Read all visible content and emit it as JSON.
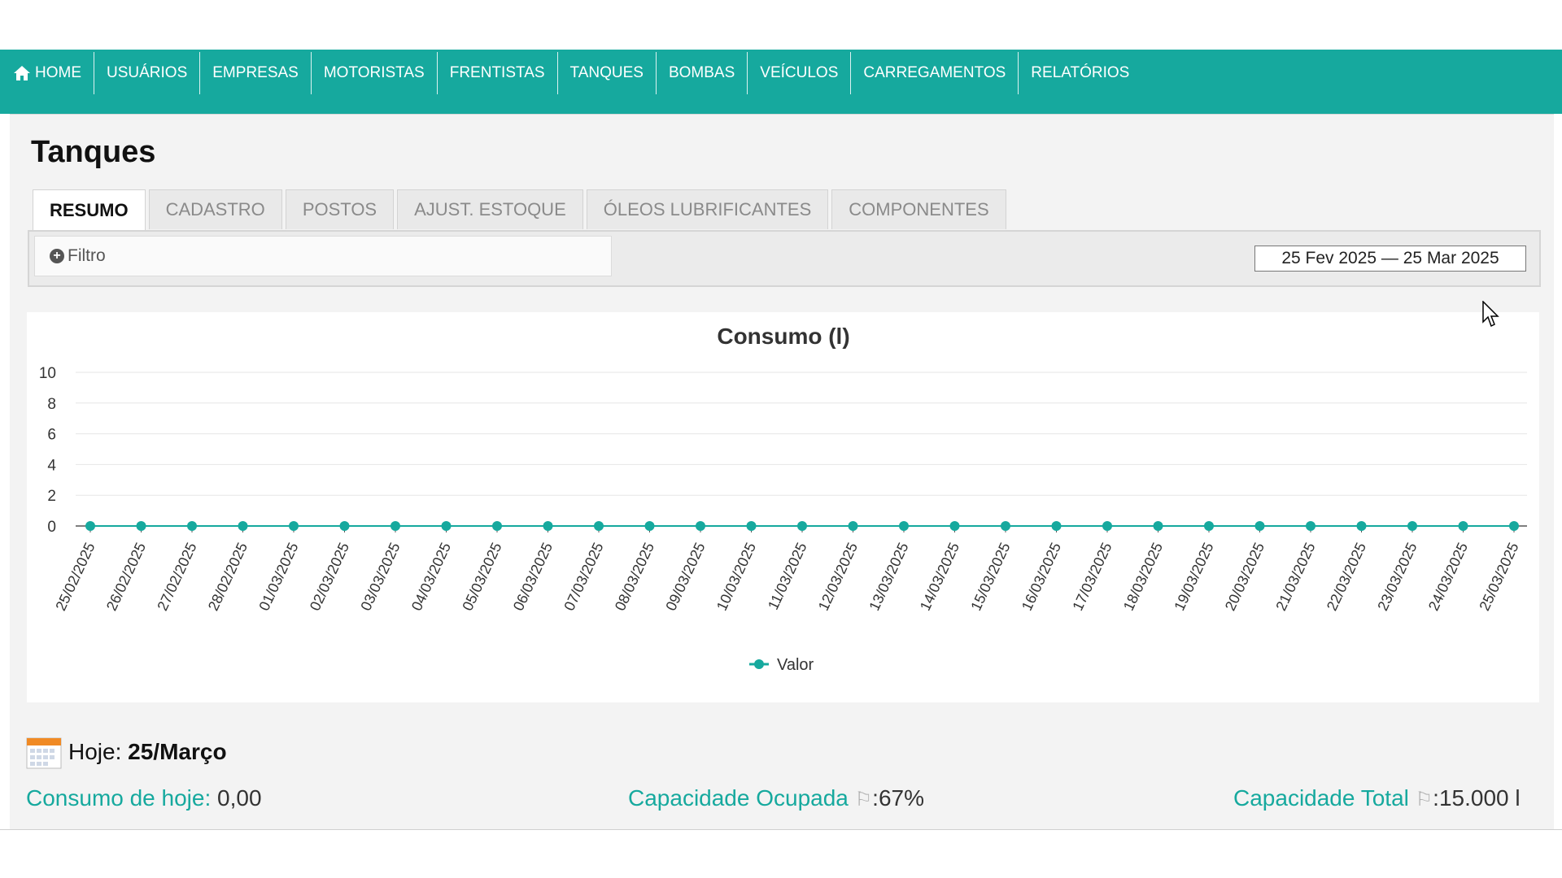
{
  "nav": {
    "items": [
      {
        "label": "HOME",
        "icon": "home-icon"
      },
      {
        "label": "USUÁRIOS"
      },
      {
        "label": "EMPRESAS"
      },
      {
        "label": "MOTORISTAS"
      },
      {
        "label": "FRENTISTAS"
      },
      {
        "label": "TANQUES"
      },
      {
        "label": "BOMBAS"
      },
      {
        "label": "VEÍCULOS"
      },
      {
        "label": "CARREGAMENTOS"
      },
      {
        "label": "RELATÓRIOS"
      }
    ]
  },
  "page": {
    "title": "Tanques"
  },
  "tabs": [
    {
      "label": "RESUMO",
      "active": true
    },
    {
      "label": "CADASTRO"
    },
    {
      "label": "POSTOS"
    },
    {
      "label": "AJUST. ESTOQUE"
    },
    {
      "label": "ÓLEOS LUBRIFICANTES"
    },
    {
      "label": "COMPONENTES"
    }
  ],
  "filter": {
    "label": "Filtro",
    "icon": "plus-circle-icon"
  },
  "date_range": {
    "label": "25 Fev 2025 — 25 Mar 2025"
  },
  "chart_data": {
    "type": "line",
    "title": "Consumo (l)",
    "xlabel": "",
    "ylabel": "",
    "ylim": [
      0,
      10
    ],
    "yticks": [
      0,
      2,
      4,
      6,
      8,
      10
    ],
    "grid": true,
    "legend_position": "bottom-center",
    "categories": [
      "25/02/2025",
      "26/02/2025",
      "27/02/2025",
      "28/02/2025",
      "01/03/2025",
      "02/03/2025",
      "03/03/2025",
      "04/03/2025",
      "05/03/2025",
      "06/03/2025",
      "07/03/2025",
      "08/03/2025",
      "09/03/2025",
      "10/03/2025",
      "11/03/2025",
      "12/03/2025",
      "13/03/2025",
      "14/03/2025",
      "15/03/2025",
      "16/03/2025",
      "17/03/2025",
      "18/03/2025",
      "19/03/2025",
      "20/03/2025",
      "21/03/2025",
      "22/03/2025",
      "23/03/2025",
      "24/03/2025",
      "25/03/2025"
    ],
    "series": [
      {
        "name": "Valor",
        "color": "#16a99e",
        "values": [
          0,
          0,
          0,
          0,
          0,
          0,
          0,
          0,
          0,
          0,
          0,
          0,
          0,
          0,
          0,
          0,
          0,
          0,
          0,
          0,
          0,
          0,
          0,
          0,
          0,
          0,
          0,
          0,
          0
        ]
      }
    ]
  },
  "today": {
    "label": "Hoje:",
    "value": "25/Março"
  },
  "stats": {
    "consumo_hoje": {
      "label": "Consumo de hoje:",
      "value": "0,00"
    },
    "capacidade_ocupada": {
      "label": "Capacidade Ocupada",
      "value": ":67%"
    },
    "capacidade_total": {
      "label": "Capacidade Total",
      "value": ":15.000 l"
    }
  },
  "colors": {
    "accent": "#16a99e",
    "nav_bg": "#16a99e"
  }
}
